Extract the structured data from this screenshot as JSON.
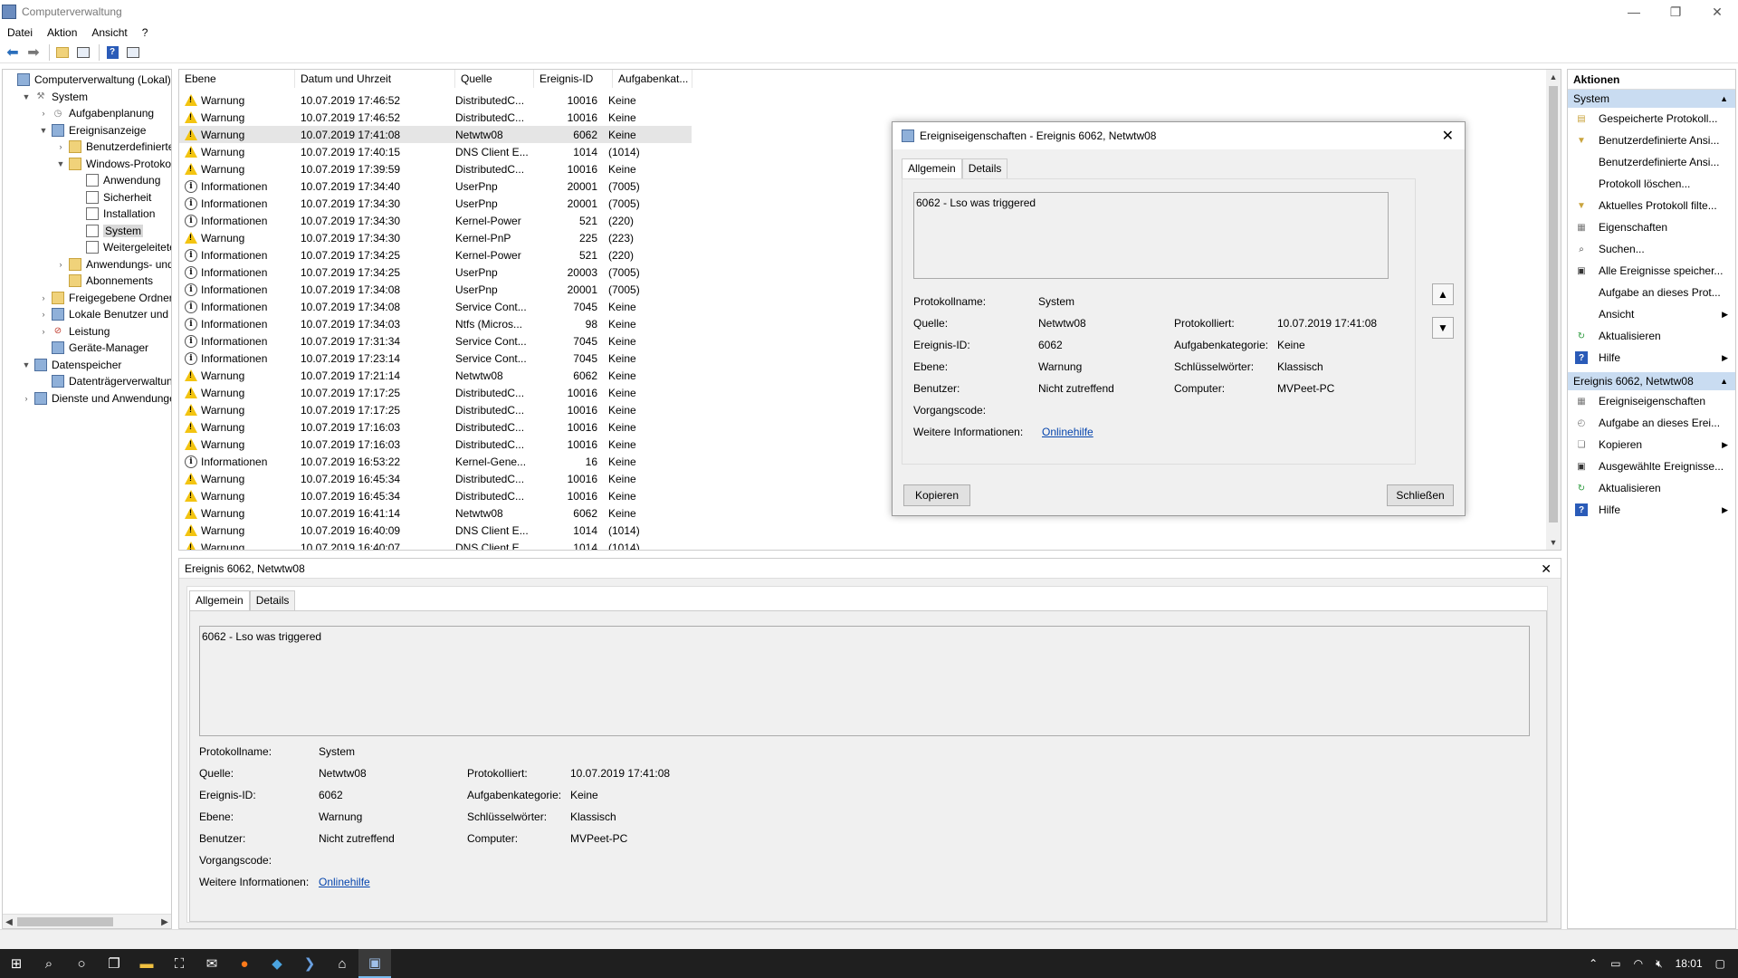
{
  "window": {
    "title": "Computerverwaltung"
  },
  "menu": [
    "Datei",
    "Aktion",
    "Ansicht",
    "?"
  ],
  "tree": [
    {
      "label": "Computerverwaltung (Lokal)",
      "depth": 0,
      "exp": "",
      "icon": "computer-icon"
    },
    {
      "label": "System",
      "depth": 1,
      "exp": "▼",
      "icon": "tools-icon"
    },
    {
      "label": "Aufgabenplanung",
      "depth": 2,
      "exp": "›",
      "icon": "clock-icon"
    },
    {
      "label": "Ereignisanzeige",
      "depth": 2,
      "exp": "▼",
      "icon": "event-viewer-icon"
    },
    {
      "label": "Benutzerdefinierte A",
      "depth": 3,
      "exp": "›",
      "icon": "folder-icon"
    },
    {
      "label": "Windows-Protokolle",
      "depth": 3,
      "exp": "▼",
      "icon": "folder-icon"
    },
    {
      "label": "Anwendung",
      "depth": 4,
      "exp": "",
      "icon": "log-icon"
    },
    {
      "label": "Sicherheit",
      "depth": 4,
      "exp": "",
      "icon": "log-icon"
    },
    {
      "label": "Installation",
      "depth": 4,
      "exp": "",
      "icon": "log-icon"
    },
    {
      "label": "System",
      "depth": 4,
      "exp": "",
      "icon": "log-icon",
      "selected": true
    },
    {
      "label": "Weitergeleitete E",
      "depth": 4,
      "exp": "",
      "icon": "log-icon"
    },
    {
      "label": "Anwendungs- und D",
      "depth": 3,
      "exp": "›",
      "icon": "folder-icon"
    },
    {
      "label": "Abonnements",
      "depth": 3,
      "exp": "",
      "icon": "folder-icon"
    },
    {
      "label": "Freigegebene Ordner",
      "depth": 2,
      "exp": "›",
      "icon": "shared-folder-icon"
    },
    {
      "label": "Lokale Benutzer und Gr",
      "depth": 2,
      "exp": "›",
      "icon": "users-icon"
    },
    {
      "label": "Leistung",
      "depth": 2,
      "exp": "›",
      "icon": "performance-icon"
    },
    {
      "label": "Geräte-Manager",
      "depth": 2,
      "exp": "",
      "icon": "device-manager-icon"
    },
    {
      "label": "Datenspeicher",
      "depth": 1,
      "exp": "▼",
      "icon": "storage-icon"
    },
    {
      "label": "Datenträgerverwaltung",
      "depth": 2,
      "exp": "",
      "icon": "disk-icon"
    },
    {
      "label": "Dienste und Anwendungen",
      "depth": 1,
      "exp": "›",
      "icon": "services-icon"
    }
  ],
  "list": {
    "columns": [
      "Ebene",
      "Datum und Uhrzeit",
      "Quelle",
      "Ereignis-ID",
      "Aufgabenkat..."
    ],
    "rows": [
      [
        "Warnung",
        "10.07.2019 17:46:52",
        "DistributedC...",
        "10016",
        "Keine"
      ],
      [
        "Warnung",
        "10.07.2019 17:46:52",
        "DistributedC...",
        "10016",
        "Keine"
      ],
      [
        "Warnung",
        "10.07.2019 17:41:08",
        "Netwtw08",
        "6062",
        "Keine"
      ],
      [
        "Warnung",
        "10.07.2019 17:40:15",
        "DNS Client E...",
        "1014",
        "(1014)"
      ],
      [
        "Warnung",
        "10.07.2019 17:39:59",
        "DistributedC...",
        "10016",
        "Keine"
      ],
      [
        "Informationen",
        "10.07.2019 17:34:40",
        "UserPnp",
        "20001",
        "(7005)"
      ],
      [
        "Informationen",
        "10.07.2019 17:34:30",
        "UserPnp",
        "20001",
        "(7005)"
      ],
      [
        "Informationen",
        "10.07.2019 17:34:30",
        "Kernel-Power",
        "521",
        "(220)"
      ],
      [
        "Warnung",
        "10.07.2019 17:34:30",
        "Kernel-PnP",
        "225",
        "(223)"
      ],
      [
        "Informationen",
        "10.07.2019 17:34:25",
        "Kernel-Power",
        "521",
        "(220)"
      ],
      [
        "Informationen",
        "10.07.2019 17:34:25",
        "UserPnp",
        "20003",
        "(7005)"
      ],
      [
        "Informationen",
        "10.07.2019 17:34:08",
        "UserPnp",
        "20001",
        "(7005)"
      ],
      [
        "Informationen",
        "10.07.2019 17:34:08",
        "Service Cont...",
        "7045",
        "Keine"
      ],
      [
        "Informationen",
        "10.07.2019 17:34:03",
        "Ntfs (Micros...",
        "98",
        "Keine"
      ],
      [
        "Informationen",
        "10.07.2019 17:31:34",
        "Service Cont...",
        "7045",
        "Keine"
      ],
      [
        "Informationen",
        "10.07.2019 17:23:14",
        "Service Cont...",
        "7045",
        "Keine"
      ],
      [
        "Warnung",
        "10.07.2019 17:21:14",
        "Netwtw08",
        "6062",
        "Keine"
      ],
      [
        "Warnung",
        "10.07.2019 17:17:25",
        "DistributedC...",
        "10016",
        "Keine"
      ],
      [
        "Warnung",
        "10.07.2019 17:17:25",
        "DistributedC...",
        "10016",
        "Keine"
      ],
      [
        "Warnung",
        "10.07.2019 17:16:03",
        "DistributedC...",
        "10016",
        "Keine"
      ],
      [
        "Warnung",
        "10.07.2019 17:16:03",
        "DistributedC...",
        "10016",
        "Keine"
      ],
      [
        "Informationen",
        "10.07.2019 16:53:22",
        "Kernel-Gene...",
        "16",
        "Keine"
      ],
      [
        "Warnung",
        "10.07.2019 16:45:34",
        "DistributedC...",
        "10016",
        "Keine"
      ],
      [
        "Warnung",
        "10.07.2019 16:45:34",
        "DistributedC...",
        "10016",
        "Keine"
      ],
      [
        "Warnung",
        "10.07.2019 16:41:14",
        "Netwtw08",
        "6062",
        "Keine"
      ],
      [
        "Warnung",
        "10.07.2019 16:40:09",
        "DNS Client E...",
        "1014",
        "(1014)"
      ],
      [
        "Warnung",
        "10.07.2019 16:40:07",
        "DNS Client E...",
        "1014",
        "(1014)"
      ]
    ],
    "selected_index": 2
  },
  "event": {
    "header": "Ereignis 6062, Netwtw08",
    "tabs": [
      "Allgemein",
      "Details"
    ],
    "description": "6062 - Lso was triggered",
    "labels": {
      "log_name": "Protokollname:",
      "source": "Quelle:",
      "event_id": "Ereignis-ID:",
      "level": "Ebene:",
      "user": "Benutzer:",
      "opcode": "Vorgangscode:",
      "more_info": "Weitere Informationen:",
      "logged": "Protokolliert:",
      "task_category": "Aufgabenkategorie:",
      "keywords": "Schlüsselwörter:",
      "computer": "Computer:"
    },
    "values": {
      "log_name": "System",
      "source": "Netwtw08",
      "event_id": "6062",
      "level": "Warnung",
      "user": "Nicht zutreffend",
      "opcode": "",
      "more_info": "Onlinehilfe",
      "logged": "10.07.2019 17:41:08",
      "task_category": "Keine",
      "keywords": "Klassisch",
      "computer": "MVPeet-PC"
    }
  },
  "dialog": {
    "title": "Ereigniseigenschaften - Ereignis 6062, Netwtw08",
    "copy_label": "Kopieren",
    "close_label": "Schließen"
  },
  "actions": {
    "title": "Aktionen",
    "section1": "System",
    "items1": [
      {
        "label": "Gespeicherte Protokoll...",
        "icon": "open-log-icon",
        "sub": false
      },
      {
        "label": "Benutzerdefinierte Ansi...",
        "icon": "filter-icon",
        "sub": false
      },
      {
        "label": "Benutzerdefinierte Ansi...",
        "icon": "",
        "sub": false
      },
      {
        "label": "Protokoll löschen...",
        "icon": "",
        "sub": false
      },
      {
        "label": "Aktuelles Protokoll filte...",
        "icon": "filter-icon",
        "sub": false
      },
      {
        "label": "Eigenschaften",
        "icon": "properties-icon",
        "sub": false
      },
      {
        "label": "Suchen...",
        "icon": "find-icon",
        "sub": false
      },
      {
        "label": "Alle Ereignisse speicher...",
        "icon": "save-icon",
        "sub": false
      },
      {
        "label": "Aufgabe an dieses Prot...",
        "icon": "",
        "sub": false
      },
      {
        "label": "Ansicht",
        "icon": "",
        "sub": true
      },
      {
        "label": "Aktualisieren",
        "icon": "refresh-icon",
        "sub": false
      },
      {
        "label": "Hilfe",
        "icon": "help-icon",
        "sub": true
      }
    ],
    "section2": "Ereignis 6062, Netwtw08",
    "items2": [
      {
        "label": "Ereigniseigenschaften",
        "icon": "properties-icon",
        "sub": false
      },
      {
        "label": "Aufgabe an dieses Erei...",
        "icon": "task-icon",
        "sub": false
      },
      {
        "label": "Kopieren",
        "icon": "copy-icon",
        "sub": true
      },
      {
        "label": "Ausgewählte Ereignisse...",
        "icon": "save-icon",
        "sub": false
      },
      {
        "label": "Aktualisieren",
        "icon": "refresh-icon",
        "sub": false
      },
      {
        "label": "Hilfe",
        "icon": "help-icon",
        "sub": true
      }
    ]
  },
  "taskbar": {
    "time": "18:01"
  }
}
